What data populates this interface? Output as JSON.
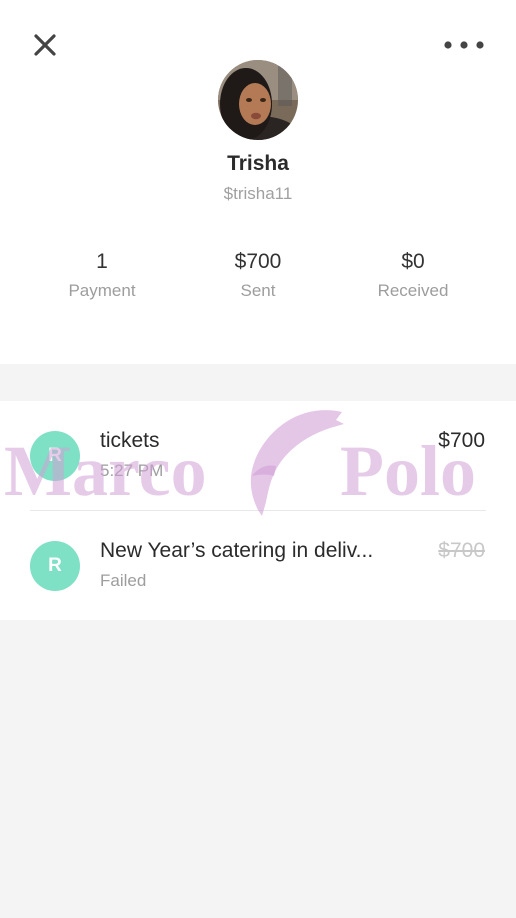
{
  "header": {
    "close_icon": "close-icon",
    "more_icon": "more-horizontal-icon"
  },
  "profile": {
    "name": "Trisha",
    "handle": "$trisha11",
    "stats": [
      {
        "value": "1",
        "label": "Payment"
      },
      {
        "value": "$700",
        "label": "Sent"
      },
      {
        "value": "$0",
        "label": "Received"
      }
    ]
  },
  "transactions": [
    {
      "initial": "R",
      "title": "tickets",
      "subtitle": "5:27 PM",
      "amount": "$700",
      "status": "completed"
    },
    {
      "initial": "R",
      "title": "New Year’s catering in deliv...",
      "subtitle": "Failed",
      "amount": "$700",
      "status": "failed"
    }
  ],
  "watermark": {
    "left_text": "Marco",
    "right_text": "Polo"
  },
  "colors": {
    "avatar_green": "#7ee0c4",
    "background_gray": "#f4f4f4",
    "watermark_pink": "#d2a0d7"
  }
}
